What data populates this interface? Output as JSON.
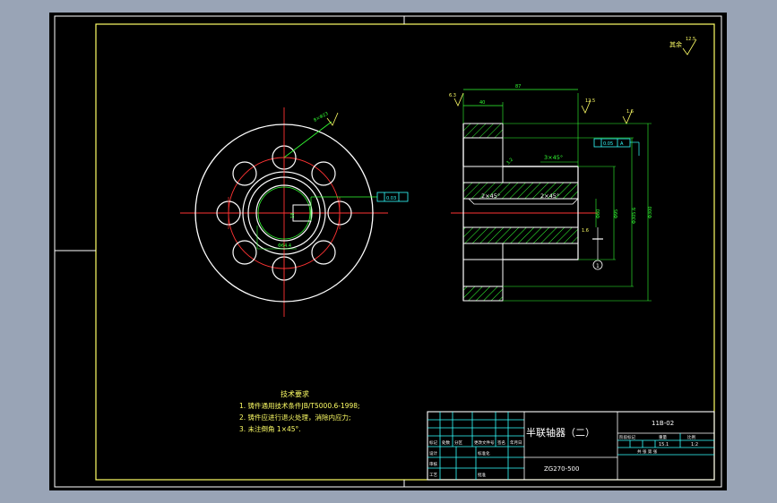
{
  "drawing": {
    "title": "半联轴器（二）",
    "drawing_number": "11B-02",
    "material": "ZG270-500",
    "scale_value": "1:2",
    "weight_value": "15.1",
    "roughness_other": "其余",
    "roughness_other_value": "12.5"
  },
  "tech_requirements": {
    "heading": "技术要求",
    "items": [
      "1. 铸件通用技术条件JB/T5000.6-1998;",
      "2. 铸件应进行退火处理，消除内应力;",
      "3. 未注倒角 1×45°."
    ]
  },
  "title_block": {
    "col_labels": [
      "标记",
      "处数",
      "分区",
      "更改文件号",
      "签名",
      "年月日"
    ],
    "role_labels": [
      "设计",
      "审核",
      "工艺",
      "标准化",
      "批准"
    ],
    "stage_labels": [
      "阶段标记",
      "重量",
      "比例"
    ],
    "sheet_info": "共 张 第 张"
  },
  "dimensions": {
    "overall_width": "87",
    "hub_width": "40",
    "chamfer_big": "3×45°",
    "chamfer_left": "2×45°",
    "chamfer_right": "2×45°",
    "bore_dia": "Φ60",
    "hub_dia": "Φ95",
    "outer_dia": "Φ300",
    "flange_dia": "Φ305.6",
    "holes": "8×Φ23",
    "keyway": "Φ64.4",
    "datum_a": "A",
    "datum_1": "1",
    "tol_front": "0.05",
    "tol_side": "0.03",
    "rough_1": "6.3",
    "rough_2": "12.5",
    "rough_3": "1.6",
    "rough_4": "3.2",
    "keywidth": "18"
  }
}
